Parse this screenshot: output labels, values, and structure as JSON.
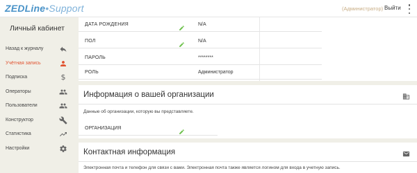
{
  "brand": {
    "name": "ZEDLine",
    "separator": "•",
    "suffix": "Support",
    "color": "#4a93c8"
  },
  "header": {
    "role": "(Администратор)",
    "logout_label": "Выйти",
    "menu_icon": "more-vert-icon"
  },
  "sidebar": {
    "title": "Личный кабинет",
    "active_color": "#e05331",
    "items": [
      {
        "label": "Назад к журналу",
        "icon": "back-arrow-icon"
      },
      {
        "label": "Учётная запись",
        "icon": "person-icon",
        "active": true
      },
      {
        "label": "Подписка",
        "icon": "dollar-icon",
        "glyph": "$"
      },
      {
        "label": "Операторы",
        "icon": "group-icon"
      },
      {
        "label": "Пользователи",
        "icon": "group-icon"
      },
      {
        "label": "Конструктор",
        "icon": "wrench-icon"
      },
      {
        "label": "Статистика",
        "icon": "trending-up-icon"
      },
      {
        "label": "Настройки",
        "icon": "gear-icon"
      }
    ]
  },
  "account": {
    "fields": [
      {
        "label": "ДАТА РОЖДЕНИЯ",
        "value": "N/A",
        "editable": true
      },
      {
        "label": "ПОЛ",
        "value": "N/A",
        "editable": true
      },
      {
        "label": "ПАРОЛЬ",
        "value": "********",
        "editable": false
      },
      {
        "label": "РОЛЬ",
        "value": "Администратор",
        "editable": false
      }
    ]
  },
  "organization": {
    "title": "Информация о вашей организации",
    "icon": "building-icon",
    "description": "Данные об организации, которую вы представляете.",
    "field_label": "ОРГАНИЗАЦИЯ"
  },
  "contact": {
    "title": "Контактная информация",
    "icon": "mail-icon",
    "description": "Электронная почта и телефон для связи с вами. Электронная почта также является логином для входа в учетную запись."
  }
}
